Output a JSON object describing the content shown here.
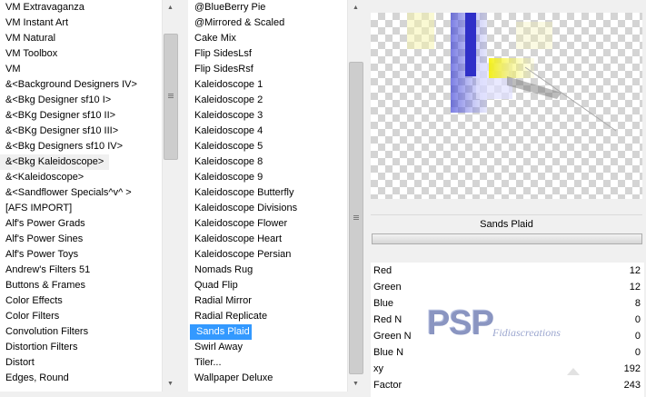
{
  "left_list": {
    "items": [
      "VM Extravaganza",
      "VM Instant Art",
      "VM Natural",
      "VM Toolbox",
      "VM",
      "&<Background Designers IV>",
      "&<Bkg Designer sf10 I>",
      "&<BKg Designer sf10 II>",
      "&<BKg Designer sf10 III>",
      "&<Bkg Designers sf10 IV>",
      "&<Bkg Kaleidoscope>",
      "&<Kaleidoscope>",
      "&<Sandflower Specials^v^ >",
      "[AFS IMPORT]",
      "Alf's Power Grads",
      "Alf's Power Sines",
      "Alf's Power Toys",
      "Andrew's Filters 51",
      "Buttons & Frames",
      "Color Effects",
      "Color Filters",
      "Convolution Filters",
      "Distortion Filters",
      "Distort",
      "Edges, Round"
    ],
    "hover_index": 10
  },
  "middle_list": {
    "items": [
      "@BlueBerry Pie",
      "@Mirrored & Scaled",
      "Cake Mix",
      "Flip SidesLsf",
      "Flip SidesRsf",
      "Kaleidoscope 1",
      "Kaleidoscope 2",
      "Kaleidoscope 3",
      "Kaleidoscope 4",
      "Kaleidoscope 5",
      "Kaleidoscope 8",
      "Kaleidoscope 9",
      "Kaleidoscope Butterfly",
      "Kaleidoscope Divisions",
      "Kaleidoscope Flower",
      "Kaleidoscope Heart",
      "Kaleidoscope Persian",
      "Nomads Rug",
      "Quad Flip",
      "Radial Mirror",
      "Radial Replicate",
      "Sands Plaid",
      "Swirl Away",
      "Tiler...",
      "Wallpaper Deluxe"
    ],
    "selected_index": 21
  },
  "preset_name": "Sands Plaid",
  "params": [
    {
      "name": "Red",
      "value": "12"
    },
    {
      "name": "Green",
      "value": "12"
    },
    {
      "name": "Blue",
      "value": "8"
    },
    {
      "name": "Red N",
      "value": "0"
    },
    {
      "name": "Green N",
      "value": "0"
    },
    {
      "name": "Blue N",
      "value": "0"
    },
    {
      "name": "xy",
      "value": "192"
    },
    {
      "name": "Factor",
      "value": "243"
    }
  ],
  "watermark": {
    "logo": "PSP",
    "credit": "Fidiascreations"
  },
  "icons": {
    "scroll_up": "scroll-up-arrow-icon",
    "scroll_down": "scroll-down-arrow-icon",
    "grip": "scroll-grip-icon"
  },
  "colors": {
    "selection": "#3399ff",
    "preview_blue": "#3b3fd6",
    "preview_yellow": "#f4f000"
  }
}
